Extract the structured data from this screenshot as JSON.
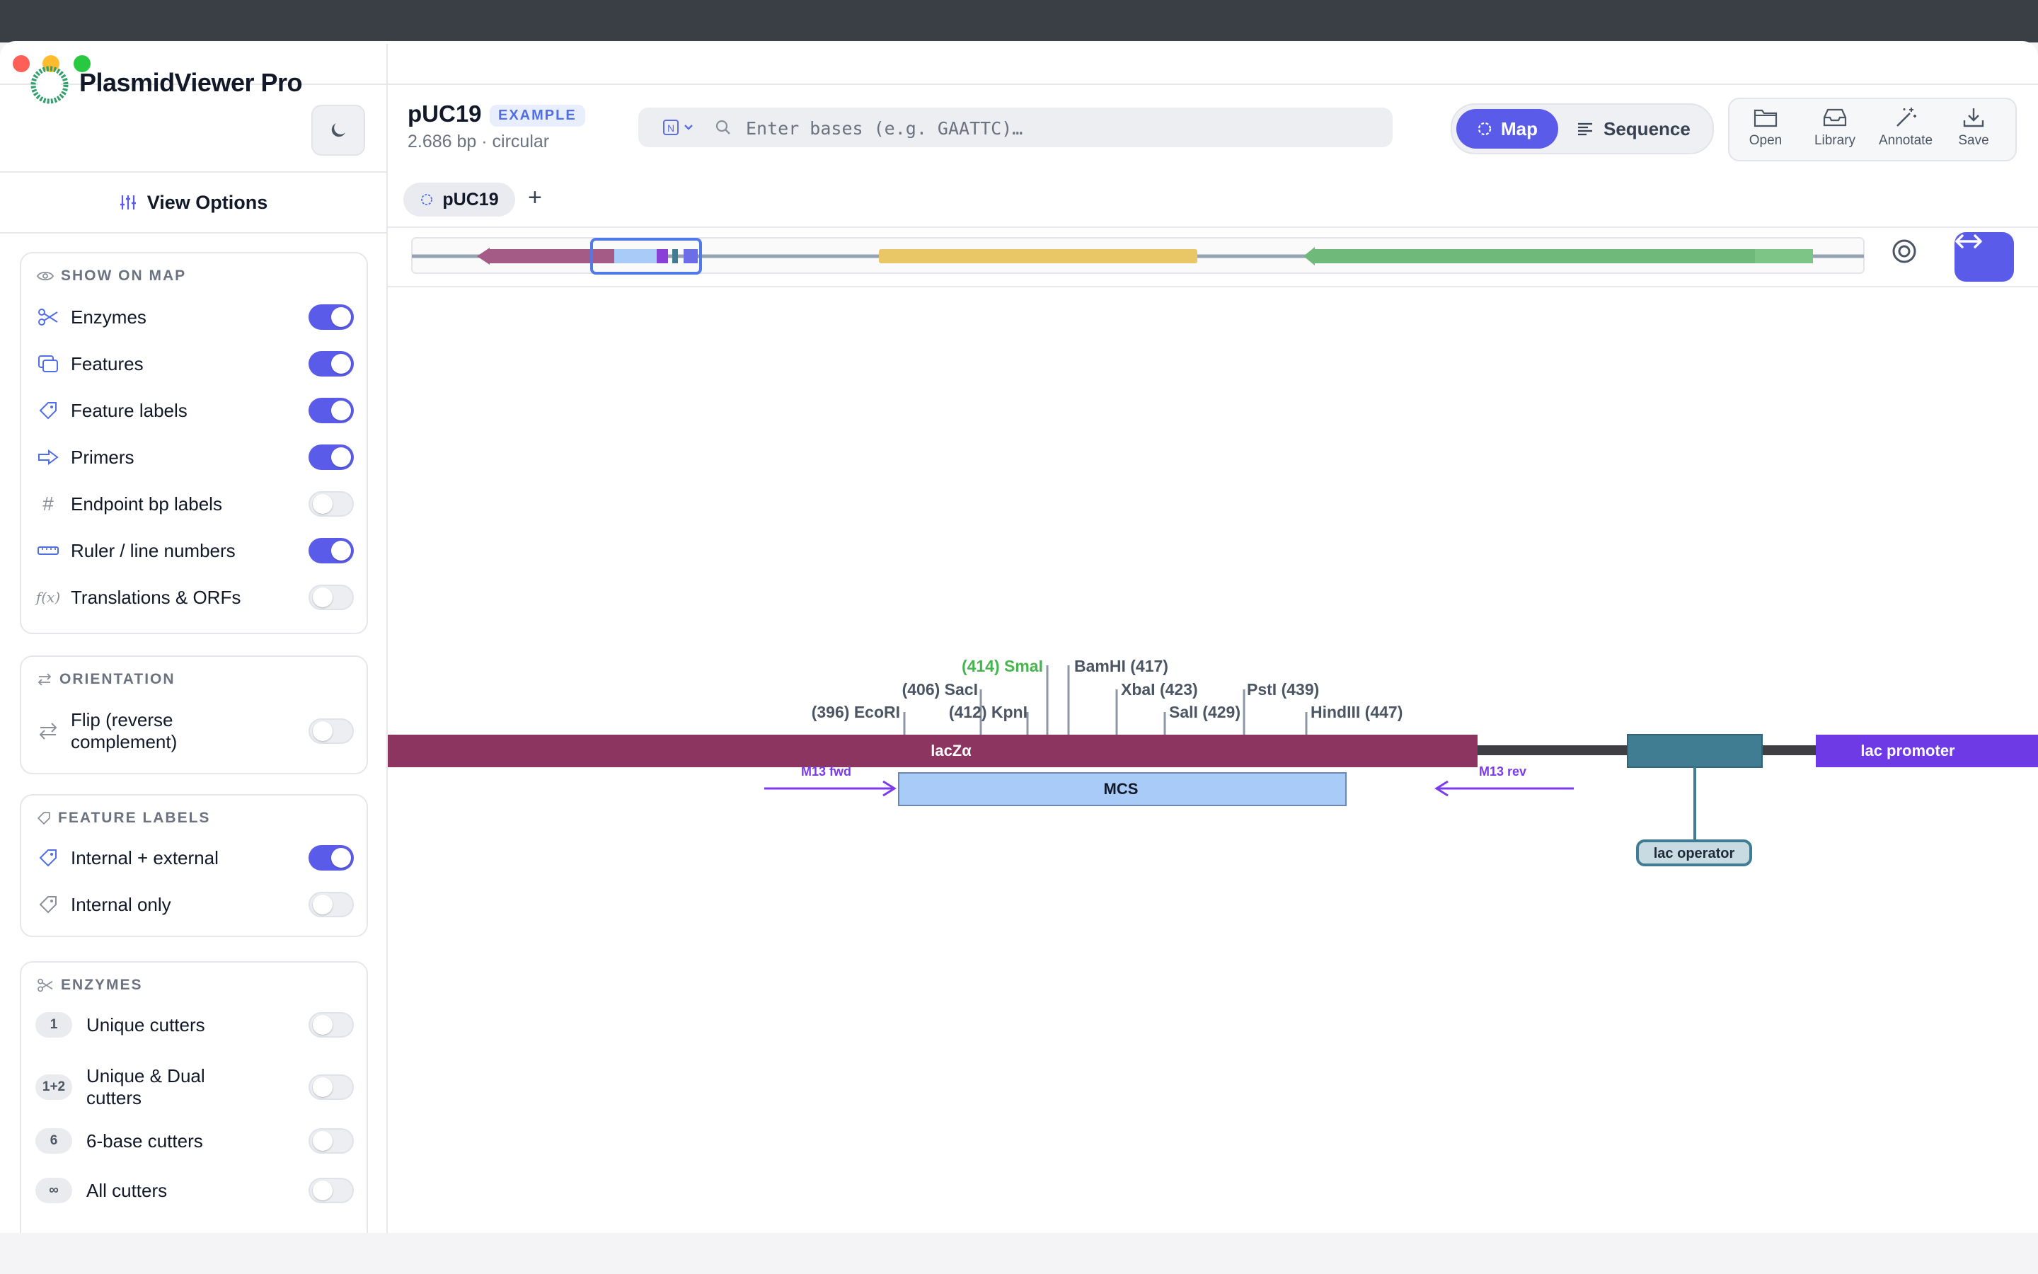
{
  "app": {
    "name": "PlasmidViewer Pro"
  },
  "document": {
    "title": "pUC19",
    "badge": "EXAMPLE",
    "subtitle": "2.686 bp · circular"
  },
  "search": {
    "placeholder": "Enter bases (e.g. GAATTC)…",
    "value": ""
  },
  "view_toggle": {
    "map_label": "Map",
    "sequence_label": "Sequence",
    "active": "Map"
  },
  "toolbar": {
    "open": "Open",
    "library": "Library",
    "annotate": "Annotate",
    "save": "Save"
  },
  "sidebar": {
    "title": "View Options",
    "show_on_map": {
      "heading": "SHOW ON MAP",
      "items": [
        {
          "label": "Enzymes",
          "on": true,
          "icon": "scissors-icon"
        },
        {
          "label": "Features",
          "on": true,
          "icon": "layers-icon"
        },
        {
          "label": "Feature labels",
          "on": true,
          "icon": "tag-icon"
        },
        {
          "label": "Primers",
          "on": true,
          "icon": "arrow-right-icon"
        },
        {
          "label": "Endpoint bp labels",
          "on": false,
          "icon": "hash-icon"
        },
        {
          "label": "Ruler / line numbers",
          "on": true,
          "icon": "ruler-icon"
        },
        {
          "label": "Translations & ORFs",
          "on": false,
          "icon": "function-icon"
        }
      ]
    },
    "orientation": {
      "heading": "ORIENTATION",
      "items": [
        {
          "label": "Flip (reverse complement)",
          "on": false,
          "icon": "swap-icon"
        }
      ]
    },
    "feature_labels": {
      "heading": "FEATURE LABELS",
      "items": [
        {
          "label": "Internal + external",
          "on": true,
          "icon": "tag-icon"
        },
        {
          "label": "Internal only",
          "on": false,
          "icon": "tag-icon"
        }
      ]
    },
    "enzymes": {
      "heading": "ENZYMES",
      "items": [
        {
          "badge": "1",
          "label": "Unique cutters",
          "on": false
        },
        {
          "badge": "1+2",
          "label": "Unique & Dual cutters",
          "on": false
        },
        {
          "badge": "6",
          "label": "6-base cutters",
          "on": false
        },
        {
          "badge": "∞",
          "label": "All cutters",
          "on": false
        }
      ]
    }
  },
  "tabs": [
    {
      "label": "pUC19"
    }
  ],
  "map": {
    "features": [
      {
        "name": "lacZα",
        "color": "#8b3560"
      },
      {
        "name": "MCS",
        "color": "#a9cbf7"
      },
      {
        "name": "lac promoter",
        "color": "#6d3ae6"
      },
      {
        "name": "lac operator",
        "color": "#407d93"
      }
    ],
    "primers": [
      {
        "name": "M13 fwd",
        "color": "#7c3aed"
      },
      {
        "name": "M13 rev",
        "color": "#7c3aed"
      }
    ],
    "enzymes": [
      {
        "label": "(396) EcoRI"
      },
      {
        "label": "(406) SacI"
      },
      {
        "label": "(412) KpnI"
      },
      {
        "label": "(414) SmaI",
        "color": "#45b64e"
      },
      {
        "label": "BamHI (417)"
      },
      {
        "label": "XbaI (423)"
      },
      {
        "label": "SalI (429)"
      },
      {
        "label": "PstI (439)"
      },
      {
        "label": "HindIII (447)"
      }
    ]
  }
}
